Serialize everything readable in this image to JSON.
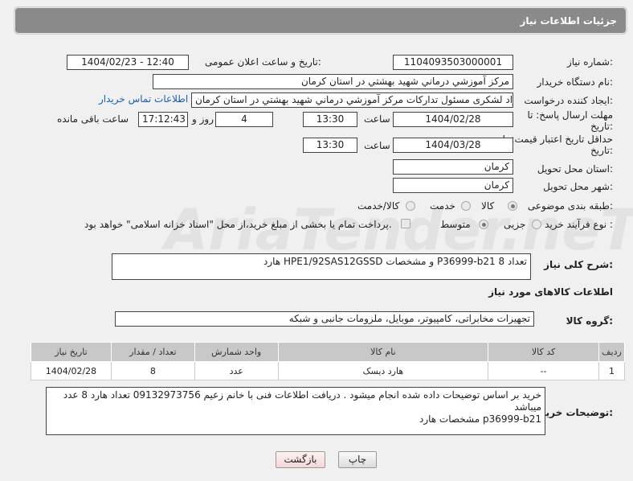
{
  "header": {
    "title": "جزئیات اطلاعات نیاز"
  },
  "form": {
    "need_number_label": "شماره نیاز:",
    "need_number": "1104093503000001",
    "announce_label": "تاریخ و ساعت اعلان عمومی:",
    "announce_value": "1404/02/23 - 12:40",
    "buyer_label": "نام دستگاه خریدار:",
    "buyer_value": "مرکز آموزشي درماني شهيد بهشتي در استان کرمان",
    "creator_label": "ایجاد کننده درخواست:",
    "creator_value": "جواد لشکری مسئول تدارکات مرکز آموزشي درماني شهيد بهشتي در استان کرمان",
    "contact_link": "اطلاعات تماس خریدار",
    "deadline_label": "مهلت ارسال پاسخ: تا تاریخ:",
    "deadline_date": "1404/02/28",
    "time_label": "ساعت",
    "deadline_time": "13:30",
    "days_value": "4",
    "days_label": "روز و",
    "remaining_time": "17:12:43",
    "remaining_label": "ساعت باقی مانده",
    "validity_label": "حداقل تاریخ اعتبار قیمت: تا تاریخ:",
    "validity_date": "1404/03/28",
    "validity_time": "13:30",
    "province_label": "استان محل تحویل:",
    "province_value": "کرمان",
    "city_label": "شهر محل تحویل:",
    "city_value": "کرمان",
    "category_label": "طبقه بندی موضوعی:",
    "category_options": [
      "کالا",
      "خدمت",
      "کالا/خدمت"
    ],
    "category_selected": "کالا",
    "process_label": "نوع فرآیند خرید :",
    "process_options": [
      "جزیی",
      "متوسط"
    ],
    "process_selected": "متوسط",
    "payment_note": "پرداخت تمام یا بخشی از مبلغ خرید،از محل \"اسناد خزانه اسلامی\" خواهد بود."
  },
  "description": {
    "label": "شرح کلی نیاز:",
    "value": "هارد HPE1/92SAS12GSSD و مشخصات P36999-b21 تعداد 8"
  },
  "goods": {
    "section_title": "اطلاعات کالاهای مورد نیاز",
    "group_label": "گروه کالا:",
    "group_value": "تجهیزات مخابراتی، کامپیوتر، موبایل، ملزومات جانبی و شبکه",
    "columns": [
      "ردیف",
      "کد کالا",
      "نام کالا",
      "واحد شمارش",
      "تعداد / مقدار",
      "تاریخ نیاز"
    ],
    "rows": [
      [
        "1",
        "--",
        "هارد دیسک",
        "عدد",
        "8",
        "1404/02/28"
      ]
    ]
  },
  "buyer_notes": {
    "label": "توضیحات خریدار:",
    "line1": "خرید بر اساس توضیحات داده شده انجام میشود . دریافت اطلاعات فنی با خانم زعیم 09132973756 تعداد هارد 8 عدد میباشد",
    "line2": "مشخصات هارد p36999-b21"
  },
  "buttons": {
    "print": "چاپ",
    "back": "بازگشت"
  },
  "watermark": "AriaTender.neT"
}
